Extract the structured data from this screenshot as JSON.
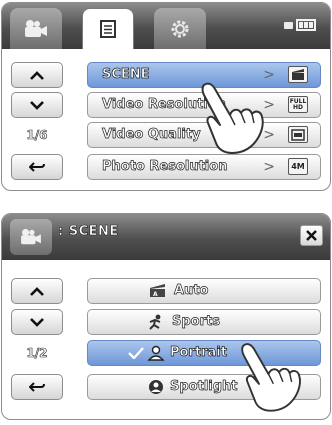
{
  "menu_panel": {
    "tabs": [
      {
        "icon": "camcorder-icon"
      },
      {
        "icon": "menu-list-icon"
      },
      {
        "icon": "settings-gear-icon"
      }
    ],
    "battery_icon": "battery-icon",
    "side_buttons": {
      "up": "chevron-up-icon",
      "down": "chevron-down-icon",
      "back": "back-arrow-icon"
    },
    "page_indicator": "1/6",
    "items": [
      {
        "label": "SCENE",
        "value_icon": "scene-mode-icon",
        "selected": true
      },
      {
        "label": "Video Resolution",
        "value_icon": "full-hd-icon",
        "value_text": "FULL HD"
      },
      {
        "label": "Video Quality",
        "value_icon": "video-quality-icon"
      },
      {
        "label": "Photo Resolution",
        "value_icon": "photo-resolution-icon",
        "value_text": "4M"
      }
    ],
    "pointer": "pointing-hand-icon"
  },
  "scene_panel": {
    "header_icon": "camcorder-icon",
    "title": ": SCENE",
    "close_icon": "close-icon",
    "side_buttons": {
      "up": "chevron-up-icon",
      "down": "chevron-down-icon",
      "back": "back-arrow-icon"
    },
    "page_indicator": "1/2",
    "options": [
      {
        "label": "Auto",
        "icon": "auto-scene-icon"
      },
      {
        "label": "Sports",
        "icon": "sports-icon"
      },
      {
        "label": "Portrait",
        "icon": "portrait-icon",
        "selected": true
      },
      {
        "label": "Spotlight",
        "icon": "spotlight-icon"
      }
    ],
    "pointer": "pointing-hand-icon"
  },
  "colors": {
    "selected_row": "#7b9fdc",
    "header": "#4e4e4e",
    "border": "#8d8d8d"
  }
}
